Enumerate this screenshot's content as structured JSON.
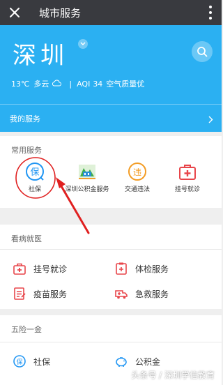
{
  "topbar": {
    "title": "城市服务",
    "close_icon": "close-icon",
    "more_icon": "more-vertical-icon"
  },
  "hero": {
    "city": "深圳",
    "temperature": "13℃",
    "condition": "多云",
    "aqi_label": "AQI",
    "aqi_value": "34",
    "air_quality": "空气质量优",
    "my_service": "我的服务",
    "bg_color": "#2bb0f2"
  },
  "common": {
    "title": "常用服务",
    "items": [
      {
        "label": "社保",
        "icon": "shebao-icon"
      },
      {
        "label": "深圳公积金服务",
        "icon": "housing-fund-icon"
      },
      {
        "label": "交通违法",
        "icon": "traffic-violation-icon"
      },
      {
        "label": "挂号就诊",
        "icon": "medical-kit-icon"
      }
    ]
  },
  "medical": {
    "title": "看病就医",
    "items": [
      {
        "label": "挂号就诊",
        "icon": "medical-kit-icon"
      },
      {
        "label": "体检服务",
        "icon": "checkup-icon"
      },
      {
        "label": "疫苗服务",
        "icon": "vaccine-icon"
      },
      {
        "label": "急救服务",
        "icon": "ambulance-icon"
      }
    ]
  },
  "insurance": {
    "title": "五险一金",
    "items": [
      {
        "label": "社保",
        "icon": "shebao-icon"
      },
      {
        "label": "公积金",
        "icon": "piggy-bank-icon"
      }
    ]
  },
  "watermark": "头条号 / 深圳学信教育",
  "colors": {
    "accent_red": "#e8454a",
    "accent_blue": "#2196f3",
    "accent_orange": "#f39c24"
  }
}
